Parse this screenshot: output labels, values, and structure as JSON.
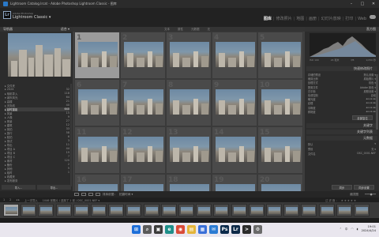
{
  "window": {
    "title": "Lightroom Catalog.lrcat - Adobe Photoshop Lightroom Classic - 图库",
    "controls": [
      "–",
      "□",
      "✕"
    ]
  },
  "brand": {
    "badge": "Lr",
    "small": "Adobe Photoshop",
    "name": "Lightroom Classic ▾"
  },
  "modules": [
    "图库",
    "修改照片",
    "地图",
    "画册",
    "幻灯片放映",
    "打印",
    "Web"
  ],
  "left_panel": {
    "navigator_label": "导航器",
    "folders": [
      {
        "name": "▸ 文件夹",
        "count": ""
      },
      {
        "name": "  ▸ 2024",
        "count": "32"
      },
      {
        "name": "  ▸ 相机导入",
        "count": "118"
      },
      {
        "name": "  ▾ 城市风光",
        "count": "64"
      },
      {
        "name": "    ▸ 高楼",
        "count": "21"
      },
      {
        "name": "    ▸ 天际线",
        "count": "40"
      },
      {
        "name": "    ▸ 延时摄影",
        "count": "640"
      },
      {
        "name": "  ▸ 风景",
        "count": "15"
      },
      {
        "name": "  ▸ 人像",
        "count": "9"
      },
      {
        "name": "  ▸ 夜景",
        "count": "27"
      },
      {
        "name": "  ▸ 建筑",
        "count": "12"
      },
      {
        "name": "  ▸ 街拍",
        "count": "33"
      },
      {
        "name": "  ▸ 旅行",
        "count": "58"
      },
      {
        "name": "  ▸ 航拍",
        "count": "6"
      },
      {
        "name": "  ▸ 测试",
        "count": "3"
      },
      {
        "name": "  ▸ 导出",
        "count": "11"
      },
      {
        "name": "  ▸ 项目 A",
        "count": "44"
      },
      {
        "name": "  ▸ 项目 B",
        "count": "19"
      },
      {
        "name": "  ▸ 项目 C",
        "count": "7"
      },
      {
        "name": "  ▸ 素材",
        "count": "120"
      },
      {
        "name": "  ▸ 备份",
        "count": "2"
      },
      {
        "name": "  ▸ 其他",
        "count": "5"
      },
      {
        "name": "  ▸ 临时",
        "count": "1"
      },
      {
        "name": "▸ 收藏夹",
        "count": ""
      },
      {
        "name": "▸ 发布服务",
        "count": ""
      }
    ],
    "selected_index": 6,
    "import_button": "导入...",
    "export_button": "导出..."
  },
  "grid": {
    "filter_items": [
      "文本",
      "属性",
      "元数据",
      "无"
    ],
    "rows": [
      [
        {
          "n": "1",
          "sel": true
        },
        {
          "n": "2"
        },
        {
          "n": "3"
        },
        {
          "n": "4"
        },
        {
          "n": "5"
        }
      ],
      [
        {
          "n": "6"
        },
        {
          "n": "7"
        },
        {
          "n": "8"
        },
        {
          "n": "9"
        },
        {
          "n": "10"
        }
      ],
      [
        {
          "n": "11"
        },
        {
          "n": "12"
        },
        {
          "n": "13"
        },
        {
          "n": "14"
        },
        {
          "n": "15"
        }
      ],
      [
        {
          "n": "16"
        },
        {
          "n": "17"
        },
        {
          "n": "18"
        },
        {
          "n": "19"
        },
        {
          "n": "20"
        }
      ]
    ]
  },
  "right_panel": {
    "histogram_label": "直方图",
    "hist_info": [
      "ISO 100",
      "24 毫米",
      "f/8",
      "1/250 秒"
    ],
    "quick_develop_label": "快速修改照片",
    "quick_rows": [
      {
        "label": "存储的预设",
        "value": "默认设置 ▾"
      },
      {
        "label": "裁剪比例",
        "value": "原始照片 ▾"
      },
      {
        "label": "处理方式",
        "value": "彩色 ▾"
      },
      {
        "label": "配置文件",
        "value": "Adobe 颜色 ▾"
      },
      {
        "label": "白平衡",
        "value": "原照设置 ▾"
      },
      {
        "label": "色调控制",
        "value": "自动"
      },
      {
        "label": "曝光度",
        "value": "◂◂ ◂ ▸ ▸▸"
      },
      {
        "label": "纹理",
        "value": "◂◂ ◂ ▸ ▸▸"
      },
      {
        "label": "清晰度",
        "value": "◂◂ ◂ ▸ ▸▸"
      },
      {
        "label": "鲜艳度",
        "value": "◂◂ ◂ ▸ ▸▸"
      }
    ],
    "reset_button": "全部复位",
    "keywording_label": "关键字",
    "keyword_list_label": "关键字列表",
    "metadata_label": "元数据",
    "metadata_rows": [
      {
        "label": "默认",
        "value": "▾"
      },
      {
        "label": "预设",
        "value": "无 ▾"
      },
      {
        "label": "文件名",
        "value": "DSC_0001.NEF"
      }
    ],
    "sync_buttons": [
      "同步",
      "同步设置"
    ]
  },
  "toolbar": {
    "sort_label": "排序依据：",
    "sort_value": "拍摄时间 ▾",
    "thumbnails_label": "缩览图"
  },
  "filmstrip": {
    "pages": [
      "1",
      "2"
    ],
    "source": "上一次导入",
    "info": "1046 张照片 / 选择了 1 张 / DSC_0001.NEF ▾",
    "filter_label": "过滤器：",
    "stars": "★★★★★",
    "count": 21,
    "selected_index": 0
  },
  "taskbar": {
    "apps": [
      {
        "name": "windows-start",
        "label": "⊞",
        "color": "#1e6fd9"
      },
      {
        "name": "search",
        "label": "⌕",
        "color": "#5a5a5a"
      },
      {
        "name": "task-view",
        "label": "▣",
        "color": "#3c3c3c"
      },
      {
        "name": "edge",
        "label": "e",
        "color": "#1f8f8a"
      },
      {
        "name": "chrome",
        "label": "◉",
        "color": "#d94a38"
      },
      {
        "name": "explorer",
        "label": "▤",
        "color": "#e4b53a"
      },
      {
        "name": "store",
        "label": "▦",
        "color": "#3a6fd8"
      },
      {
        "name": "mail",
        "label": "✉",
        "color": "#2b7bd3"
      },
      {
        "name": "photoshop",
        "label": "Ps",
        "color": "#0b2a4b"
      },
      {
        "name": "lightroom",
        "label": "Lr",
        "color": "#0e2a48"
      },
      {
        "name": "terminal",
        "label": ">",
        "color": "#2b2b2b"
      },
      {
        "name": "settings",
        "label": "⚙",
        "color": "#6a6a6a"
      }
    ],
    "tray_text": "中",
    "time": "19:01",
    "date": "2024/4/24"
  }
}
